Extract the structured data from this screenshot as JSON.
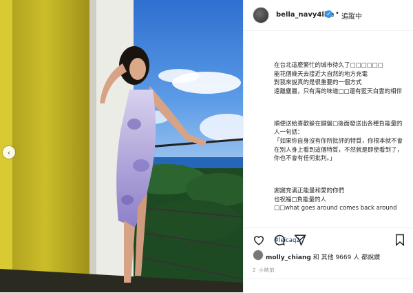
{
  "post": {
    "username": "bella_navy4life",
    "follow_label": "追蹤中",
    "separator": "•",
    "caption_lines": [
      "在台北這麼繁忙的城市待久了□□□□□□",
      "能花個幾天去接近大自然的地方充電",
      "對我來說真的是很重要的一個方式",
      "遠離塵囂，只有海的味道□□還有藍天白雲的相伴"
    ],
    "caption_para2": [
      "順便送給喜歡躲在鍵盤□後面發送出各種負能量的人一句話：",
      "「如果你自身沒有你所批評的特質，你根本就不會在別人身上看到這個特質，不然就是即使看到了，你也不會有任何批判。」"
    ],
    "caption_para3": [
      "謝謝充滿正能量和愛的你們",
      "也祝福□負能量的人",
      "□□what goes around comes back around"
    ],
    "hashtag": "#leicaq2",
    "liked_by_user": "molly_chiang",
    "likes_text": "和 其他 9669 人 都說讚",
    "timestamp": "2 小時前",
    "icons": {
      "like": "heart-icon",
      "comment": "comment-icon",
      "share": "paper-plane-icon",
      "save": "bookmark-icon",
      "prev": "chevron-left-icon"
    },
    "colors": {
      "accent": "#3897f0",
      "text": "#262626",
      "muted": "#8e8e8e",
      "hashtag": "#00376b"
    }
  }
}
